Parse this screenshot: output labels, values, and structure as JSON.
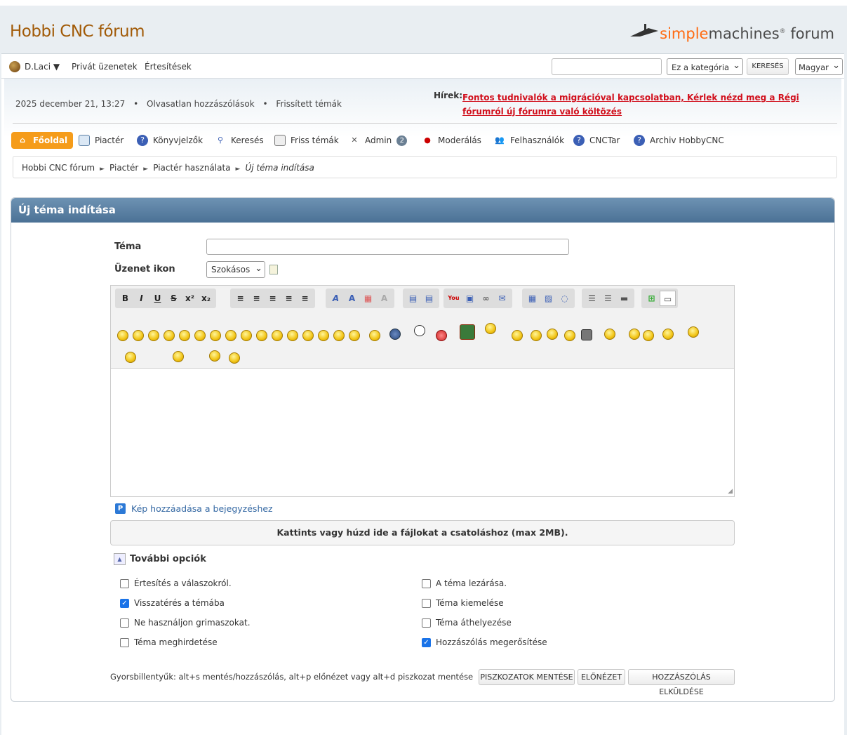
{
  "forum_title": "Hobbi CNC fórum",
  "logo": {
    "part1": "simple",
    "part2": "machines",
    "sup": "®",
    "part3": " forum"
  },
  "userbar": {
    "username": "D.Laci ▼",
    "private_messages": "Privát üzenetek",
    "notifications": "Értesítések",
    "category_select": "Ez a kategória",
    "search_button": "KERESÉS",
    "language": "Magyar"
  },
  "info": {
    "datetime": "2025 december 21, 13:27",
    "unread": "Olvasatlan hozzászólások",
    "updated": "Frissített témák",
    "dot": "•",
    "news_label": "Hírek:",
    "news_text": "Fontos tudnivalók a migrációval kapcsolatban, Kérlek nézd meg a Régi fórumról új fórumra való költözés"
  },
  "nav": [
    {
      "label": "Főoldal",
      "icon": "home-icon"
    },
    {
      "label": "Piactér",
      "icon": "market-icon"
    },
    {
      "label": "Könyvjelzők",
      "icon": "help-icon"
    },
    {
      "label": "Keresés",
      "icon": "search-icon"
    },
    {
      "label": "Friss témák",
      "icon": "recent-icon"
    },
    {
      "label": "Admin",
      "icon": "admin-icon",
      "badge": "2"
    },
    {
      "label": "Moderálás",
      "icon": "traffic-light-icon"
    },
    {
      "label": "Felhasználók",
      "icon": "users-icon"
    },
    {
      "label": "CNCTar",
      "icon": "help-icon"
    },
    {
      "label": "Archiv HobbyCNC",
      "icon": "help-icon"
    }
  ],
  "breadcrumb": {
    "items": [
      "Hobbi CNC fórum",
      "Piactér",
      "Piactér használata"
    ],
    "current": "Új téma indítása",
    "sep": "►"
  },
  "panel": {
    "title": "Új téma indítása",
    "subject_label": "Téma",
    "icon_label": "Üzenet ikon",
    "icon_select": "Szokásos",
    "add_image": "Kép hozzáadása a bejegyzéshez",
    "dropzone": "Kattints vagy húzd ide a fájlokat a csatoláshoz (max 2MB).",
    "more_options": "További opciók",
    "options": [
      {
        "label": "Értesítés a válaszokról.",
        "checked": false
      },
      {
        "label": "A téma lezárása.",
        "checked": false
      },
      {
        "label": "Visszatérés a témába",
        "checked": true
      },
      {
        "label": "Téma kiemelése",
        "checked": false
      },
      {
        "label": "Ne használjon grimaszokat.",
        "checked": false
      },
      {
        "label": "Téma áthelyezése",
        "checked": false
      },
      {
        "label": "Téma meghirdetése",
        "checked": false
      },
      {
        "label": "Hozzászólás megerősítése",
        "checked": true
      }
    ],
    "shortcuts": "Gyorsbillentyűk: alt+s mentés/hozzászólás, alt+p előnézet vagy alt+d piszkozat mentése",
    "buttons": {
      "drafts": "PISZKOZATOK MENTÉSE",
      "preview": "ELŐNÉZET",
      "post": "HOZZÁSZÓLÁS ELKÜLDÉSE"
    }
  },
  "colors": {
    "accent": "#f59c1a",
    "title": "#a15a07",
    "header_bar": "#4b7195",
    "news": "#d1101d"
  }
}
